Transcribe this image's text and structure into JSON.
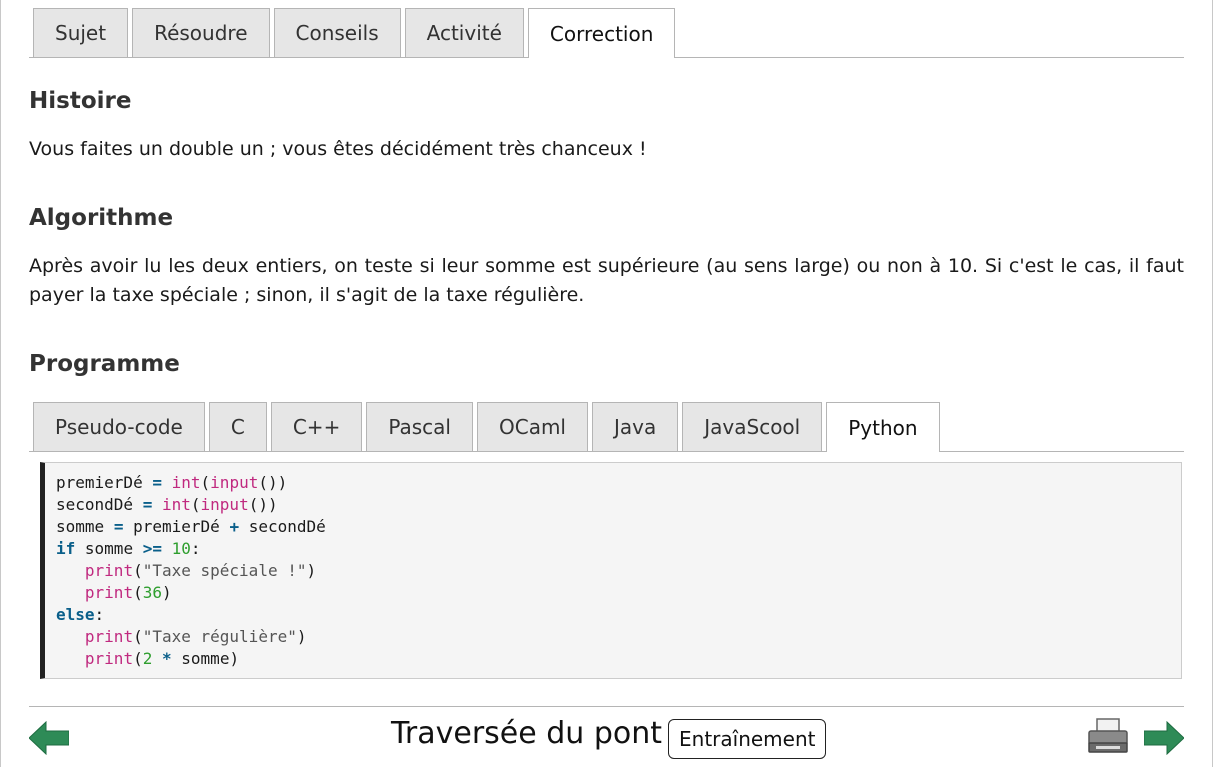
{
  "main_tabs": [
    {
      "label": "Sujet"
    },
    {
      "label": "Résoudre"
    },
    {
      "label": "Conseils"
    },
    {
      "label": "Activité"
    },
    {
      "label": "Correction",
      "active": true
    }
  ],
  "sections": {
    "history": {
      "title": "Histoire",
      "text": "Vous faites un double un ; vous êtes décidément très chanceux !"
    },
    "algorithm": {
      "title": "Algorithme",
      "text": "Après avoir lu les deux entiers, on teste si leur somme est supérieure (au sens large) ou non à 10. Si c'est le cas, il faut payer la taxe spéciale ; sinon, il s'agit de la taxe régulière."
    },
    "program": {
      "title": "Programme"
    }
  },
  "language_tabs": [
    {
      "label": "Pseudo-code"
    },
    {
      "label": "C"
    },
    {
      "label": "C++"
    },
    {
      "label": "Pascal"
    },
    {
      "label": "OCaml"
    },
    {
      "label": "Java"
    },
    {
      "label": "JavaScool"
    },
    {
      "label": "Python",
      "active": true
    }
  ],
  "code": {
    "var_first": "premierDé",
    "var_second": "secondDé",
    "var_sum": "somme",
    "fn_int": "int",
    "fn_input": "input",
    "fn_print": "print",
    "kw_if": "if",
    "kw_else": "else",
    "op_assign": "=",
    "op_plus": "+",
    "op_ge": ">=",
    "op_mul": "*",
    "num_10": "10",
    "num_36": "36",
    "num_2": "2",
    "str_special": "\"Taxe spéciale !\"",
    "str_regular": "\"Taxe régulière\""
  },
  "footer": {
    "title": "Traversée du pont",
    "badge": "Entraînement"
  },
  "colors": {
    "arrow_green": "#2e8b57",
    "keyword": "#0a5f8a",
    "function": "#c0297f",
    "number": "#2e9e2e"
  },
  "icons": {
    "prev": "arrow-left-icon",
    "next": "arrow-right-icon",
    "print": "printer-icon"
  }
}
